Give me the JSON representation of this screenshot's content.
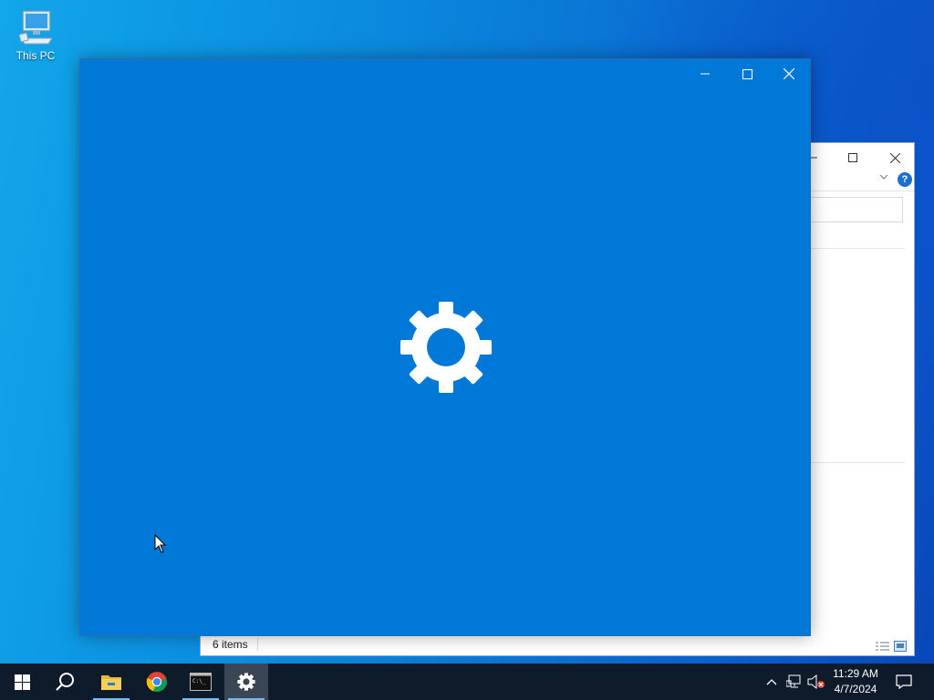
{
  "desktop": {
    "icons": [
      {
        "label": "This PC",
        "icon": "computer-icon"
      }
    ]
  },
  "explorer": {
    "status_text": "6 items",
    "controls": [
      "minimize",
      "maximize",
      "close"
    ],
    "help_label": "?"
  },
  "settings_window": {
    "background": "#0078d7",
    "icon": "gear-icon",
    "controls": [
      "minimize",
      "maximize",
      "close"
    ]
  },
  "taskbar": {
    "apps": [
      {
        "name": "start",
        "icon": "windows-logo-icon"
      },
      {
        "name": "search",
        "icon": "search-icon"
      },
      {
        "name": "file-explorer",
        "icon": "folder-icon"
      },
      {
        "name": "chrome",
        "icon": "chrome-icon"
      },
      {
        "name": "command-prompt",
        "icon": "terminal-icon"
      },
      {
        "name": "settings",
        "icon": "gear-icon",
        "active": true
      }
    ],
    "tray": {
      "time": "11:29 AM",
      "date": "4/7/2024",
      "icons": [
        "chevron-up-icon",
        "network-icon",
        "volume-muted-icon",
        "notification-icon"
      ]
    }
  }
}
